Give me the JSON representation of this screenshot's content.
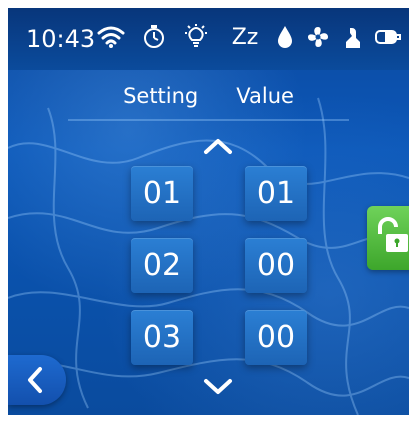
{
  "status": {
    "time": "10:43",
    "icons": [
      "wifi-icon",
      "timer-icon",
      "light-bulb-icon",
      "sleep-icon",
      "water-drop-icon",
      "fan-icon",
      "filter-icon",
      "lamp-icon"
    ],
    "sleep_text": "Zz"
  },
  "header": {
    "setting_label": "Setting",
    "value_label": "Value"
  },
  "rows": [
    {
      "setting": "01",
      "value": "01"
    },
    {
      "setting": "02",
      "value": "00"
    },
    {
      "setting": "03",
      "value": "00"
    }
  ],
  "colors": {
    "accent": "#1d64b5",
    "lock_green": "#3da62b",
    "status_bar": "#08367b"
  },
  "controls": {
    "scroll_up": "chevron-up-icon",
    "scroll_down": "chevron-down-icon",
    "back": "chevron-left-icon",
    "lock": "unlock-icon"
  }
}
